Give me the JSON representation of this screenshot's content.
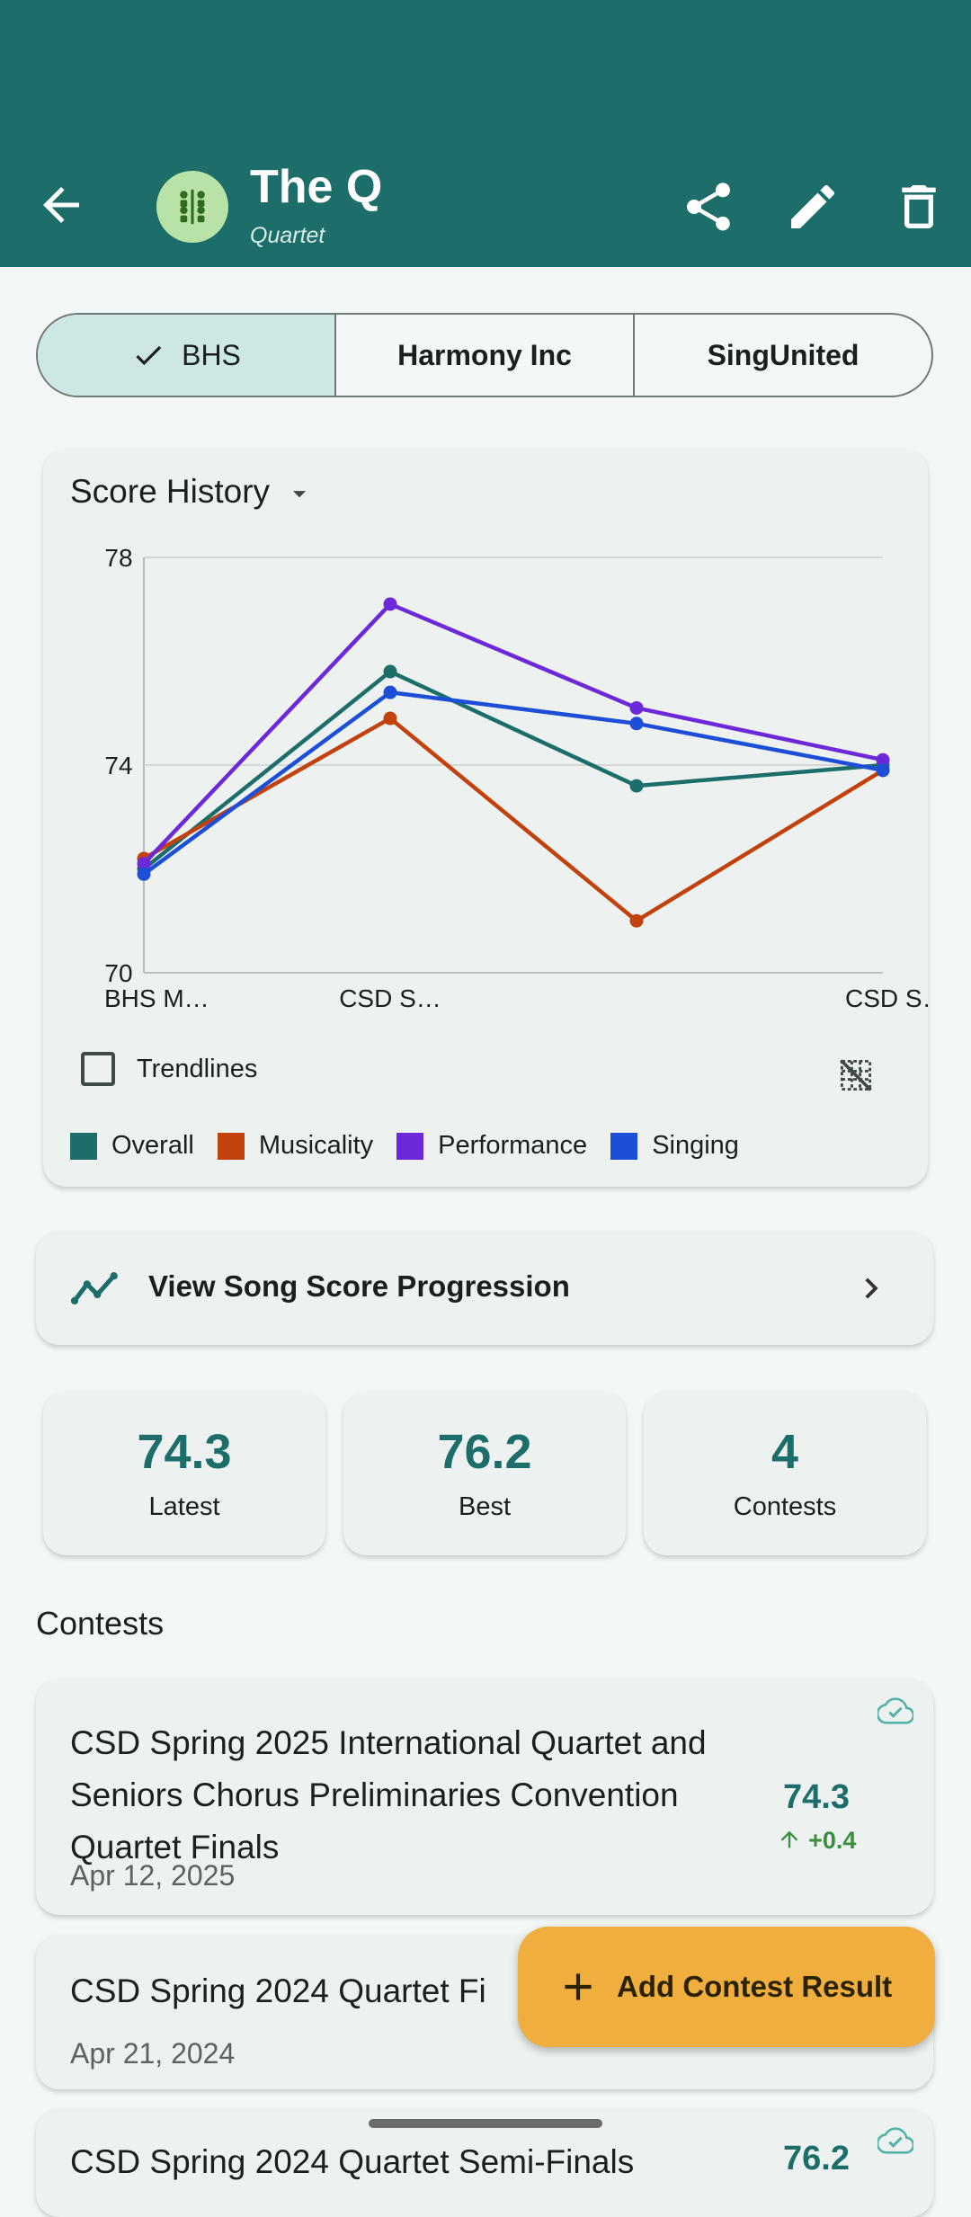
{
  "header": {
    "title": "The Q",
    "subtitle": "Quartet"
  },
  "tabs": [
    {
      "label": "BHS",
      "selected": true
    },
    {
      "label": "Harmony Inc",
      "selected": false
    },
    {
      "label": "SingUnited",
      "selected": false
    }
  ],
  "chart_card": {
    "title": "Score History",
    "trendlines_label": "Trendlines",
    "trendlines_checked": false
  },
  "chart_data": {
    "type": "line",
    "categories": [
      "BHS M…",
      "CSD S…",
      "",
      "CSD S…"
    ],
    "ylim": [
      70,
      78
    ],
    "yticks": [
      "78",
      "74",
      "70"
    ],
    "grid": true,
    "legend_position": "bottom",
    "series": [
      {
        "name": "Overall",
        "color": "#1d6e6a",
        "values": [
          72.0,
          75.8,
          73.6,
          74.0
        ]
      },
      {
        "name": "Musicality",
        "color": "#c2410c",
        "values": [
          72.2,
          74.9,
          71.0,
          73.9
        ]
      },
      {
        "name": "Performance",
        "color": "#6d28d9",
        "values": [
          72.1,
          77.1,
          75.1,
          74.1
        ]
      },
      {
        "name": "Singing",
        "color": "#1d4ed8",
        "values": [
          71.9,
          75.4,
          74.8,
          73.9
        ]
      }
    ]
  },
  "progression": {
    "label": "View Song Score Progression"
  },
  "stats": [
    {
      "value": "74.3",
      "label": "Latest"
    },
    {
      "value": "76.2",
      "label": "Best"
    },
    {
      "value": "4",
      "label": "Contests"
    }
  ],
  "contests_section": {
    "title": "Contests"
  },
  "contests": [
    {
      "title": "CSD Spring 2025 International Quartet and Seniors Chorus Preliminaries Convention Quartet Finals",
      "date": "Apr 12, 2025",
      "score": "74.3",
      "delta": "+0.4"
    },
    {
      "title": "CSD Spring 2024 Quartet Fi",
      "date": "Apr 21, 2024"
    },
    {
      "title": "CSD Spring 2024 Quartet Semi-Finals",
      "score": "76.2"
    }
  ],
  "fab": {
    "label": "Add Contest Result"
  }
}
